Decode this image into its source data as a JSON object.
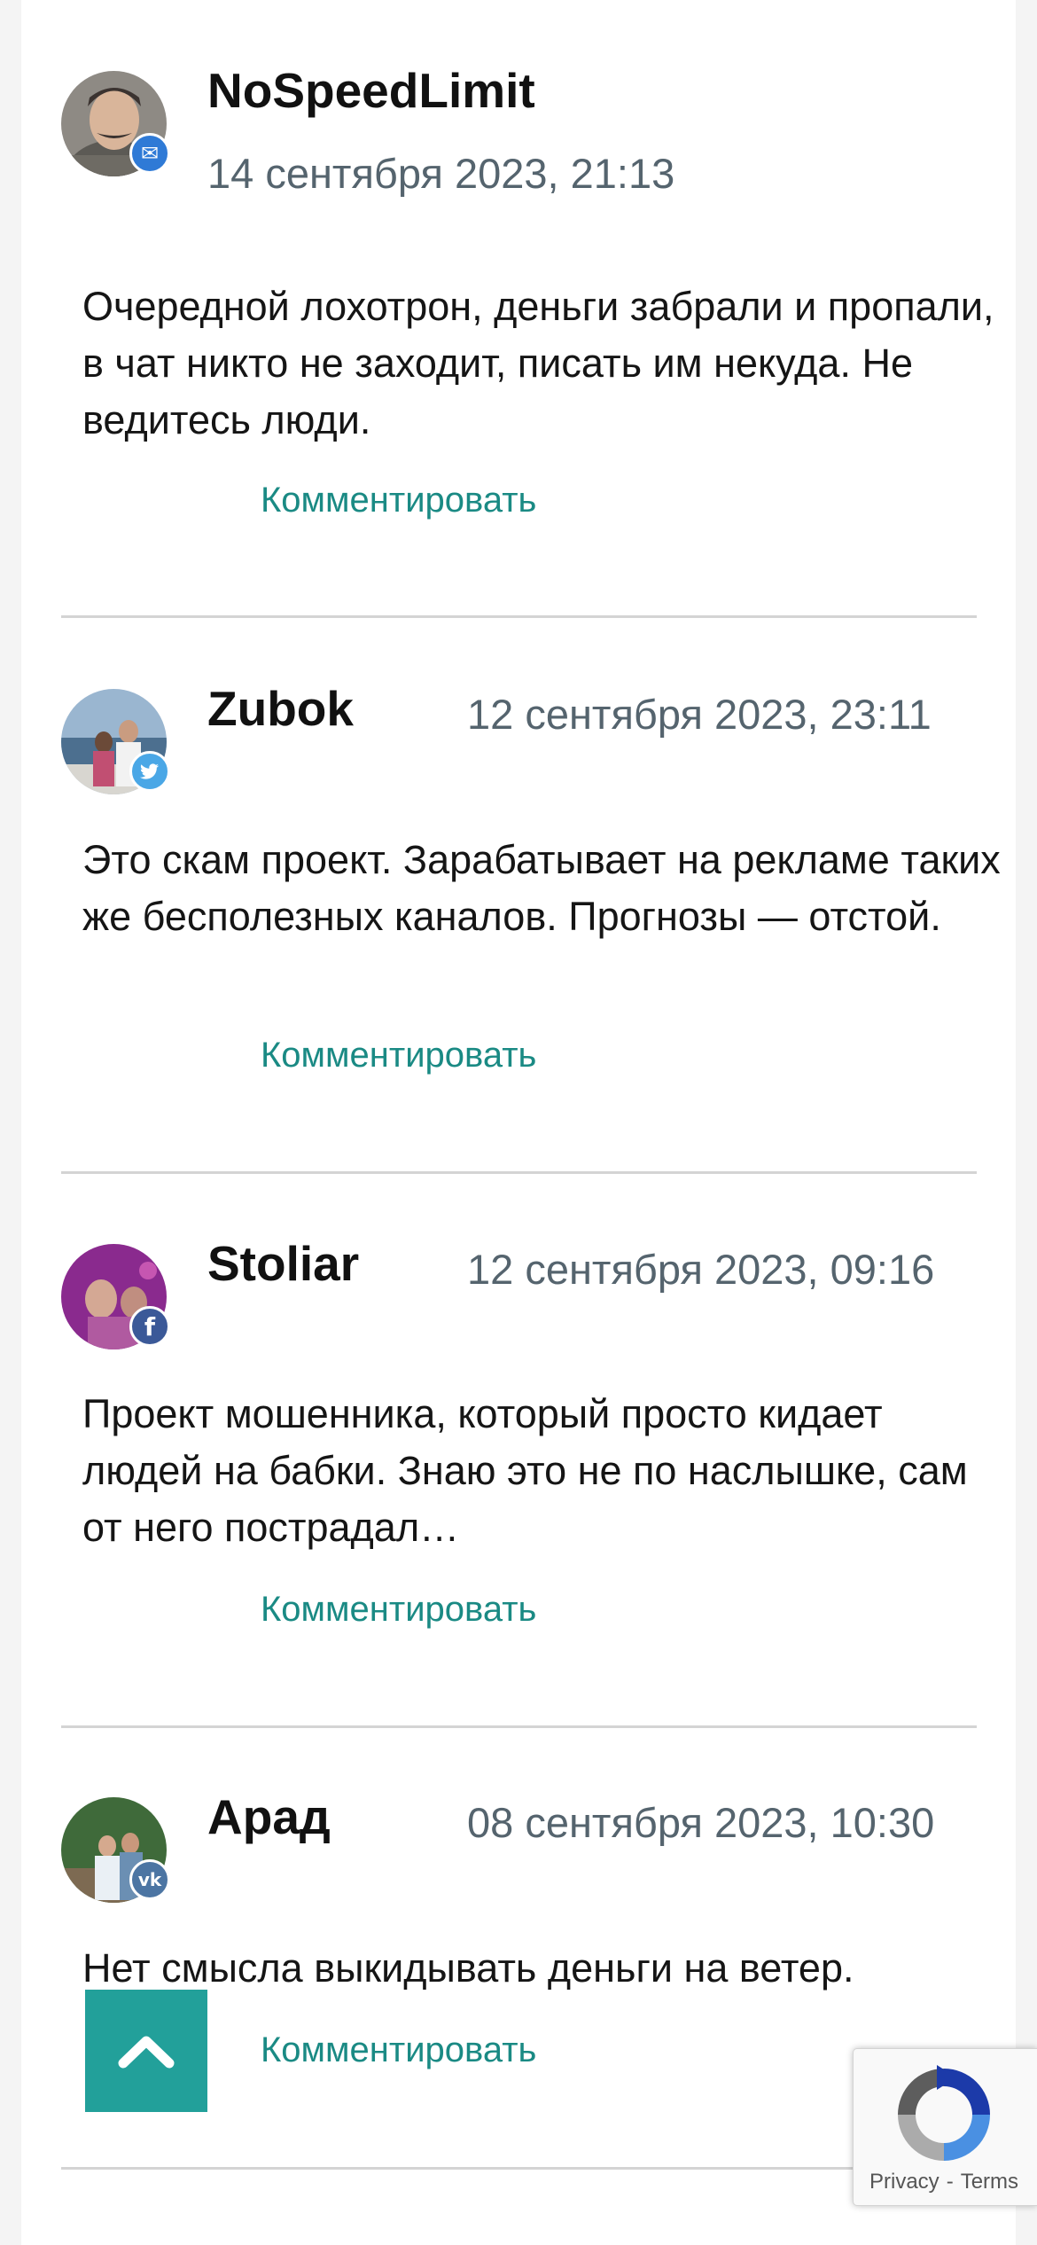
{
  "comments": [
    {
      "author": "NoSpeedLimit",
      "date": "14 сентября 2023, 21:13",
      "text": "Очередной лохотрон, деньги забрали и пропали, в чат никто не заходит, писать им некуда. Не ведитесь люди.",
      "reply_label": "Комментировать",
      "social": "email",
      "social_glyph": "✉",
      "social_color": "#2f7ad6"
    },
    {
      "author": "Zubok",
      "date": "12 сентября 2023, 23:11",
      "text": "Это скам проект. Зарабатывает на рекламе таких же бесполезных каналов. Прогнозы — отстой.",
      "reply_label": "Комментировать",
      "social": "twitter",
      "social_glyph": "🐦",
      "social_color": "#4aa7e6"
    },
    {
      "author": "Stoliar",
      "date": "12 сентября 2023, 09:16",
      "text": "Проект мошенника, который просто кидает людей на бабки. Знаю это не по наслышке, сам от него пострадал…",
      "reply_label": "Комментировать",
      "social": "facebook",
      "social_glyph": "f",
      "social_color": "#3b5998"
    },
    {
      "author": "Арад",
      "date": "08 сентября 2023, 10:30",
      "text": "Нет смысла выкидывать деньги на ветер.",
      "reply_label": "Комментировать",
      "social": "vk",
      "social_glyph": "vk",
      "social_color": "#4c75a3"
    }
  ],
  "recaptcha": {
    "privacy_label": "Privacy",
    "separator": "-",
    "terms_label": "Terms",
    "icon": "recaptcha-logo"
  },
  "scroll_top": {
    "icon": "chevron-up-icon"
  }
}
